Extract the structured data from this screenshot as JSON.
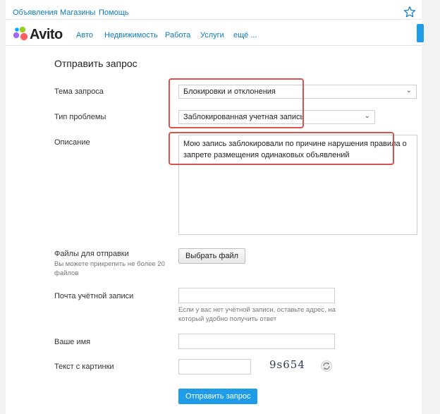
{
  "topnav": {
    "links": [
      "Объявления",
      "Магазины",
      "Помощь"
    ]
  },
  "header": {
    "logo_text": "Avito",
    "nav": [
      "Авто",
      "Недвижимость",
      "Работа",
      "Услуги",
      "ещё ..."
    ]
  },
  "form": {
    "title": "Отправить запрос",
    "topic": {
      "label": "Тема запроса",
      "value": "Блокировки и отклонения"
    },
    "problem": {
      "label": "Тип проблемы",
      "value": "Заблокированная учетная запись"
    },
    "description": {
      "label": "Описание",
      "value": "Мою запись заблокировали по причине нарушения правила о запрете размещения одинаковых объявлений"
    },
    "files": {
      "label": "Файлы для отправки",
      "note": "Вы можете прикрепить не более 20 файлов",
      "button": "Выбрать файл"
    },
    "email": {
      "label": "Почта учётной записи",
      "value": "",
      "hint": "Если у вас нет учётной записи, оставьте адрес, на который удобно получить ответ"
    },
    "name": {
      "label": "Ваше имя",
      "value": ""
    },
    "captcha": {
      "label": "Текст с картинки",
      "value": "",
      "image_text": "9s654"
    },
    "submit": "Отправить запрос"
  },
  "colors": {
    "accent": "#1e9ce8",
    "link": "#0a7cc1",
    "highlight": "#d9534f"
  },
  "icons": {
    "favorite": "star-icon",
    "refresh": "refresh-icon"
  }
}
